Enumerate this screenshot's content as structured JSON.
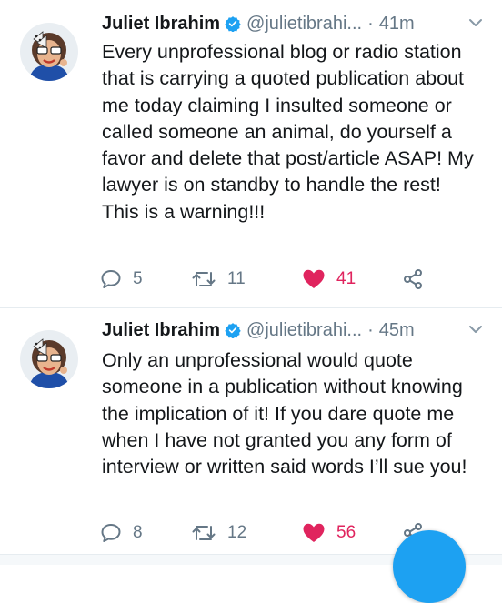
{
  "tweets": [
    {
      "name": "Juliet Ibrahim",
      "handle": "@julietibrahi...",
      "separator": "·",
      "time": "41m",
      "text": "Every unprofessional blog or radio station that is carrying a quoted publication about me today claiming I insulted someone or called someone an animal, do yourself a favor and delete that post/article ASAP! My lawyer is on standby to handle the rest! This is a warning!!!",
      "replies": "5",
      "retweets": "11",
      "likes": "41"
    },
    {
      "name": "Juliet Ibrahim",
      "handle": "@julietibrahi...",
      "separator": "·",
      "time": "45m",
      "text": "Only an unprofessional would quote someone in a publication without knowing the implication of it! If you dare quote me when I have not granted you any form of interview or written said words I’ll sue you!",
      "replies": "8",
      "retweets": "12",
      "likes": "56"
    }
  ],
  "colors": {
    "like_red": "#e0245e",
    "accent_blue": "#1da1f2",
    "muted_gray": "#657786"
  },
  "icons": [
    "verified-icon",
    "chevron-down-icon",
    "reply-icon",
    "retweet-icon",
    "heart-icon",
    "share-icon"
  ]
}
